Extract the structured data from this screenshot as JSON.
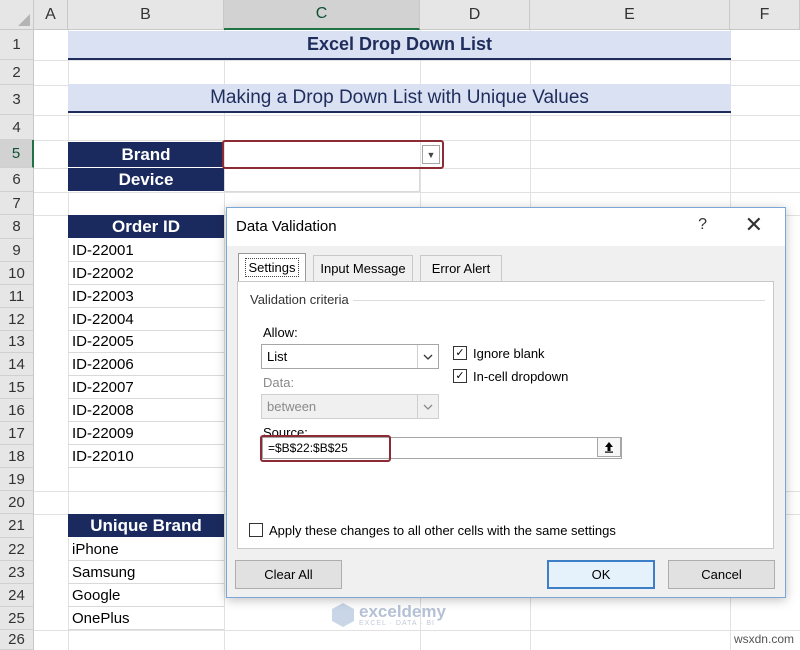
{
  "columns": [
    "A",
    "B",
    "C",
    "D",
    "E",
    "F"
  ],
  "rows": [
    "1",
    "2",
    "3",
    "4",
    "5",
    "6",
    "7",
    "8",
    "9",
    "10",
    "11",
    "12",
    "13",
    "14",
    "15",
    "16",
    "17",
    "18",
    "19",
    "20",
    "21",
    "22",
    "23",
    "24",
    "25",
    "26"
  ],
  "sheet": {
    "title": "Excel Drop Down List",
    "subtitle": "Making a Drop Down List with Unique Values",
    "brand_label": "Brand",
    "device_label": "Device",
    "order_header": "Order ID",
    "orders": [
      "ID-22001",
      "ID-22002",
      "ID-22003",
      "ID-22004",
      "ID-22005",
      "ID-22006",
      "ID-22007",
      "ID-22008",
      "ID-22009",
      "ID-22010"
    ],
    "unique_header": "Unique Brand",
    "unique_brands": [
      "iPhone",
      "Samsung",
      "Google",
      "OnePlus"
    ]
  },
  "dialog": {
    "title": "Data Validation",
    "help": "?",
    "close": "✕",
    "tabs": [
      "Settings",
      "Input Message",
      "Error Alert"
    ],
    "group_title": "Validation criteria",
    "allow_label": "Allow:",
    "allow_value": "List",
    "data_label": "Data:",
    "data_value": "between",
    "ignore_blank": "Ignore blank",
    "in_cell_dropdown": "In-cell dropdown",
    "source_label": "Source:",
    "source_value": "=$B$22:$B$25",
    "apply_all": "Apply these changes to all other cells with the same settings",
    "clear_all": "Clear All",
    "ok": "OK",
    "cancel": "Cancel"
  },
  "watermark": {
    "name": "exceldemy",
    "tagline": "EXCEL · DATA · BI"
  },
  "site_mark": "wsxdn.com",
  "colors": {
    "navy": "#1b2a5e",
    "banner": "#d9e1f2",
    "highlight": "#8c2b35",
    "excel_green": "#217346"
  }
}
